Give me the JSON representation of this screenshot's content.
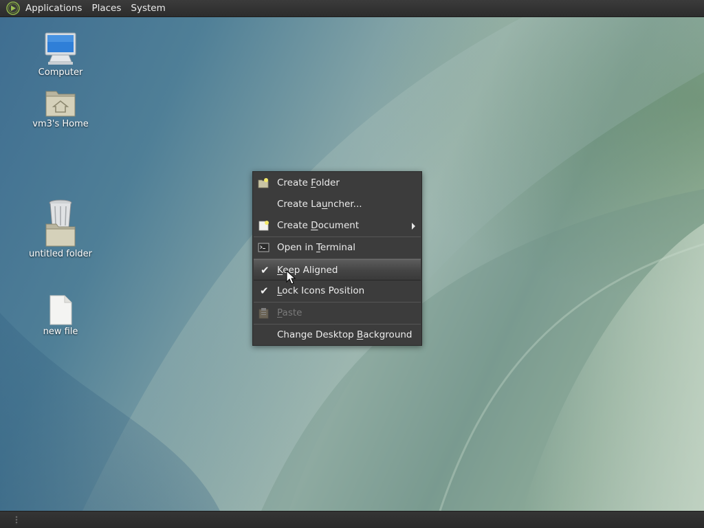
{
  "panel": {
    "menus": [
      {
        "label": "Applications"
      },
      {
        "label": "Places"
      },
      {
        "label": "System"
      }
    ],
    "logo_icon": "distro-logo-icon"
  },
  "desktop": {
    "icons": [
      {
        "label": "Computer",
        "icon": "computer-icon"
      },
      {
        "label": "vm3's Home",
        "icon": "home-folder-icon"
      },
      {
        "label": "untitled folder",
        "icon": "folder-icon"
      },
      {
        "label": "new file",
        "icon": "file-icon"
      }
    ],
    "trash_icon": "trash-icon"
  },
  "context_menu": {
    "items": [
      {
        "pre": "Create ",
        "key": "F",
        "post": "older",
        "icon": "new-folder-icon"
      },
      {
        "pre": "Create La",
        "key": "u",
        "post": "ncher...",
        "icon": ""
      },
      {
        "pre": "Create ",
        "key": "D",
        "post": "ocument",
        "icon": "new-document-icon",
        "submenu": true
      },
      {
        "pre": "Open in ",
        "key": "T",
        "post": "erminal",
        "icon": "terminal-icon"
      },
      {
        "pre": "",
        "key": "K",
        "post": "eep Aligned",
        "checked": true,
        "highlighted": true
      },
      {
        "pre": "",
        "key": "L",
        "post": "ock Icons Position",
        "checked": true
      },
      {
        "pre": "",
        "key": "P",
        "post": "aste",
        "icon": "paste-icon",
        "disabled": true
      },
      {
        "pre": "Change Desktop ",
        "key": "B",
        "post": "ackground",
        "icon": ""
      }
    ]
  },
  "colors": {
    "panel_bg": "#2f2f2f",
    "menu_bg": "#3c3c3c",
    "menu_text": "#ececec",
    "disabled_text": "#7a7a7a"
  }
}
